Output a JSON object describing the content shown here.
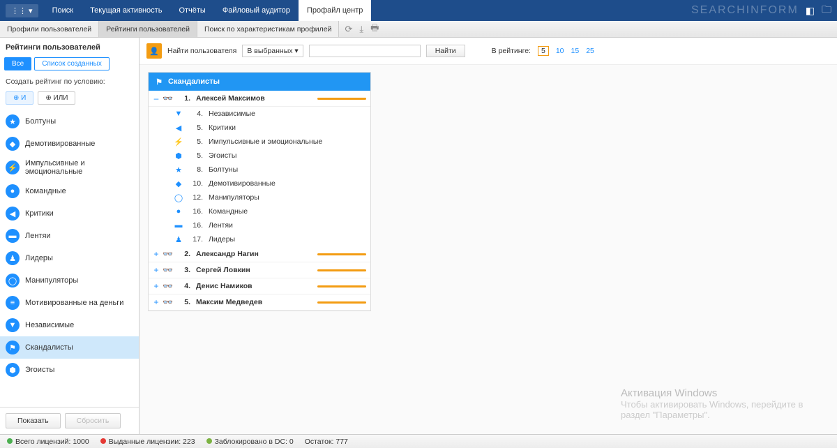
{
  "topbar": {
    "menu": "⋮⋮ ▾",
    "nav": [
      "Поиск",
      "Текущая активность",
      "Отчёты",
      "Файловый аудитор",
      "Профайл центр"
    ],
    "active_index": 4,
    "brand": "SEARCHINFORM"
  },
  "subtabs": {
    "items": [
      "Профили пользователей",
      "Рейтинги пользователей",
      "Поиск по характеристикам профилей"
    ],
    "active_index": 1
  },
  "sidebar": {
    "title": "Рейтинги пользователей",
    "filter_all": "Все",
    "filter_created": "Список созданных",
    "create_label": "Создать рейтинг по условию:",
    "and": "⊕ И",
    "or": "⊕ ИЛИ",
    "categories": [
      {
        "icon": "★",
        "label": "Болтуны"
      },
      {
        "icon": "◆",
        "label": "Демотивированные"
      },
      {
        "icon": "⚡",
        "label": "Импульсивные и эмоциональные"
      },
      {
        "icon": "●",
        "label": "Командные"
      },
      {
        "icon": "◀",
        "label": "Критики"
      },
      {
        "icon": "▬",
        "label": "Лентяи"
      },
      {
        "icon": "♟",
        "label": "Лидеры"
      },
      {
        "icon": "◯",
        "label": "Манипуляторы"
      },
      {
        "icon": "≡",
        "label": "Мотивированные на деньги"
      },
      {
        "icon": "▼",
        "label": "Независимые"
      },
      {
        "icon": "⚑",
        "label": "Скандалисты"
      },
      {
        "icon": "⬢",
        "label": "Эгоисты"
      }
    ],
    "selected_index": 10,
    "show_btn": "Показать",
    "clear_btn": "Сбросить"
  },
  "search": {
    "find_label": "Найти пользователя",
    "scope": "В выбранных ▾",
    "find_btn": "Найти",
    "rank_label": "В рейтинге:",
    "rank_options": [
      "5",
      "10",
      "15",
      "25"
    ],
    "rank_active_index": 0
  },
  "panel": {
    "title": "Скандалисты",
    "rows": [
      {
        "num": "1.",
        "name": "Алексей Максимов"
      },
      {
        "num": "2.",
        "name": "Александр Нагин"
      },
      {
        "num": "3.",
        "name": "Сергей Ловкин"
      },
      {
        "num": "4.",
        "name": "Денис Намиков"
      },
      {
        "num": "5.",
        "name": "Максим Медведев"
      }
    ],
    "details": [
      {
        "icon": "▼",
        "num": "4.",
        "name": "Независимые"
      },
      {
        "icon": "◀",
        "num": "5.",
        "name": "Критики"
      },
      {
        "icon": "⚡",
        "num": "5.",
        "name": "Импульсивные и эмоциональные"
      },
      {
        "icon": "⬢",
        "num": "5.",
        "name": "Эгоисты"
      },
      {
        "icon": "★",
        "num": "8.",
        "name": "Болтуны"
      },
      {
        "icon": "◆",
        "num": "10.",
        "name": "Демотивированные"
      },
      {
        "icon": "◯",
        "num": "12.",
        "name": "Манипуляторы"
      },
      {
        "icon": "●",
        "num": "16.",
        "name": "Командные"
      },
      {
        "icon": "▬",
        "num": "16.",
        "name": "Лентяи"
      },
      {
        "icon": "♟",
        "num": "17.",
        "name": "Лидеры"
      }
    ]
  },
  "status": {
    "total": "Всего лицензий: 1000",
    "issued": "Выданные лицензии: 223",
    "blocked": "Заблокировано в DC: 0",
    "remain": "Остаток: 777"
  },
  "watermark": {
    "title": "Активация Windows",
    "text": "Чтобы активировать Windows, перейдите в раздел \"Параметры\"."
  }
}
